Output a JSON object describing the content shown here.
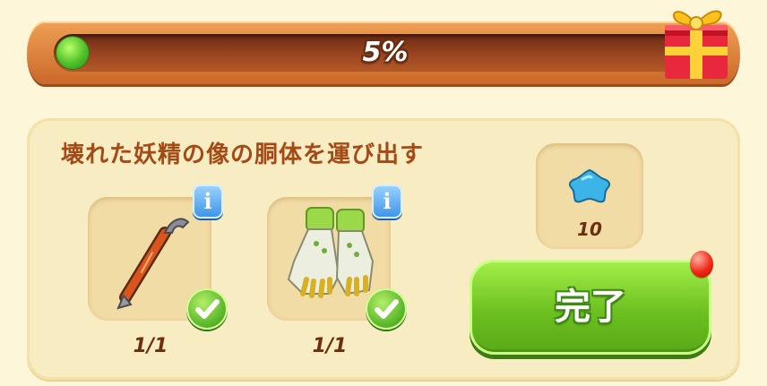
{
  "progress": {
    "percent_label": "5%",
    "value": 0.05
  },
  "task": {
    "title": "壊れた妖精の像の胴体を運び出す",
    "items": [
      {
        "icon": "crowbar-icon",
        "count": "1/1",
        "completed": true
      },
      {
        "icon": "gloves-icon",
        "count": "1/1",
        "completed": true
      }
    ],
    "reward": {
      "icon": "blue-star-icon",
      "amount": "10"
    }
  },
  "complete_button": {
    "label": "完了"
  },
  "colors": {
    "background": "#fdf6d8",
    "title": "#a34a16",
    "progress_fill": "#4fc02a",
    "complete_button": "#6cc020",
    "info_button": "#3c93e6",
    "notification": "#f02818"
  }
}
